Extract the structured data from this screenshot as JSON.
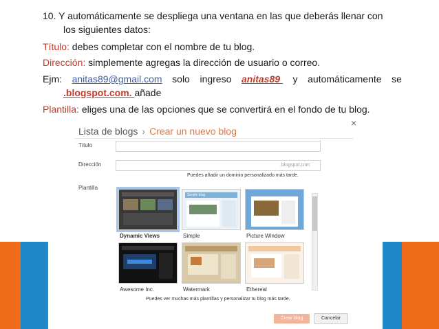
{
  "slide": {
    "step_number": "10.",
    "line1": "Y automáticamente se despliega una ventana en las que deberás llenar con",
    "line2": "los siguientes datos:",
    "titulo_label": "Título:",
    "titulo_text": "debes completar con el nombre de tu blog.",
    "direccion_label": "Dirección:",
    "direccion_text": "simplemente agregas la dirección  de usuario o correo.",
    "ejm_words": [
      "Ejm:",
      "anitas89@gmail.com",
      "solo",
      "ingreso",
      "anitas89 ",
      "y",
      "automáticamente",
      "se"
    ],
    "blogspot": ".blogspot.com. ",
    "anade": "añade",
    "plantilla_label": "Plantilla:",
    "plantilla_text": "eliges una de las opciones que se convertirá en el fondo de tu blog."
  },
  "dialog": {
    "breadcrumb_root": "Lista de blogs",
    "breadcrumb_sep": "›",
    "breadcrumb_current": "Crear un nuevo blog",
    "close": "×",
    "titulo_label": "Título",
    "direccion_label": "Dirección",
    "direccion_suffix": ".blogspot.com",
    "domain_hint": "Puedes añadir un dominio personalizado más tarde.",
    "plantilla_label": "Plantilla",
    "templates": [
      {
        "name": "Dynamic Views",
        "selected": true
      },
      {
        "name": "Simple",
        "selected": false
      },
      {
        "name": "Picture Window",
        "selected": false
      },
      {
        "name": "Awesome Inc.",
        "selected": false
      },
      {
        "name": "Watermark",
        "selected": false
      },
      {
        "name": "Ethereal",
        "selected": false
      }
    ],
    "thumb_simple_title": "Simple blog",
    "more_hint": "Puedes ver muchas más plantillas y personalizar tu blog más tarde.",
    "create_button": "Crear blog",
    "cancel_button": "Cancelar"
  },
  "colors": {
    "accent_red": "#c0392b",
    "orange_deco": "#ef6c1a",
    "blue_deco": "#1e88c8",
    "blogger_orange": "#e8743b"
  }
}
